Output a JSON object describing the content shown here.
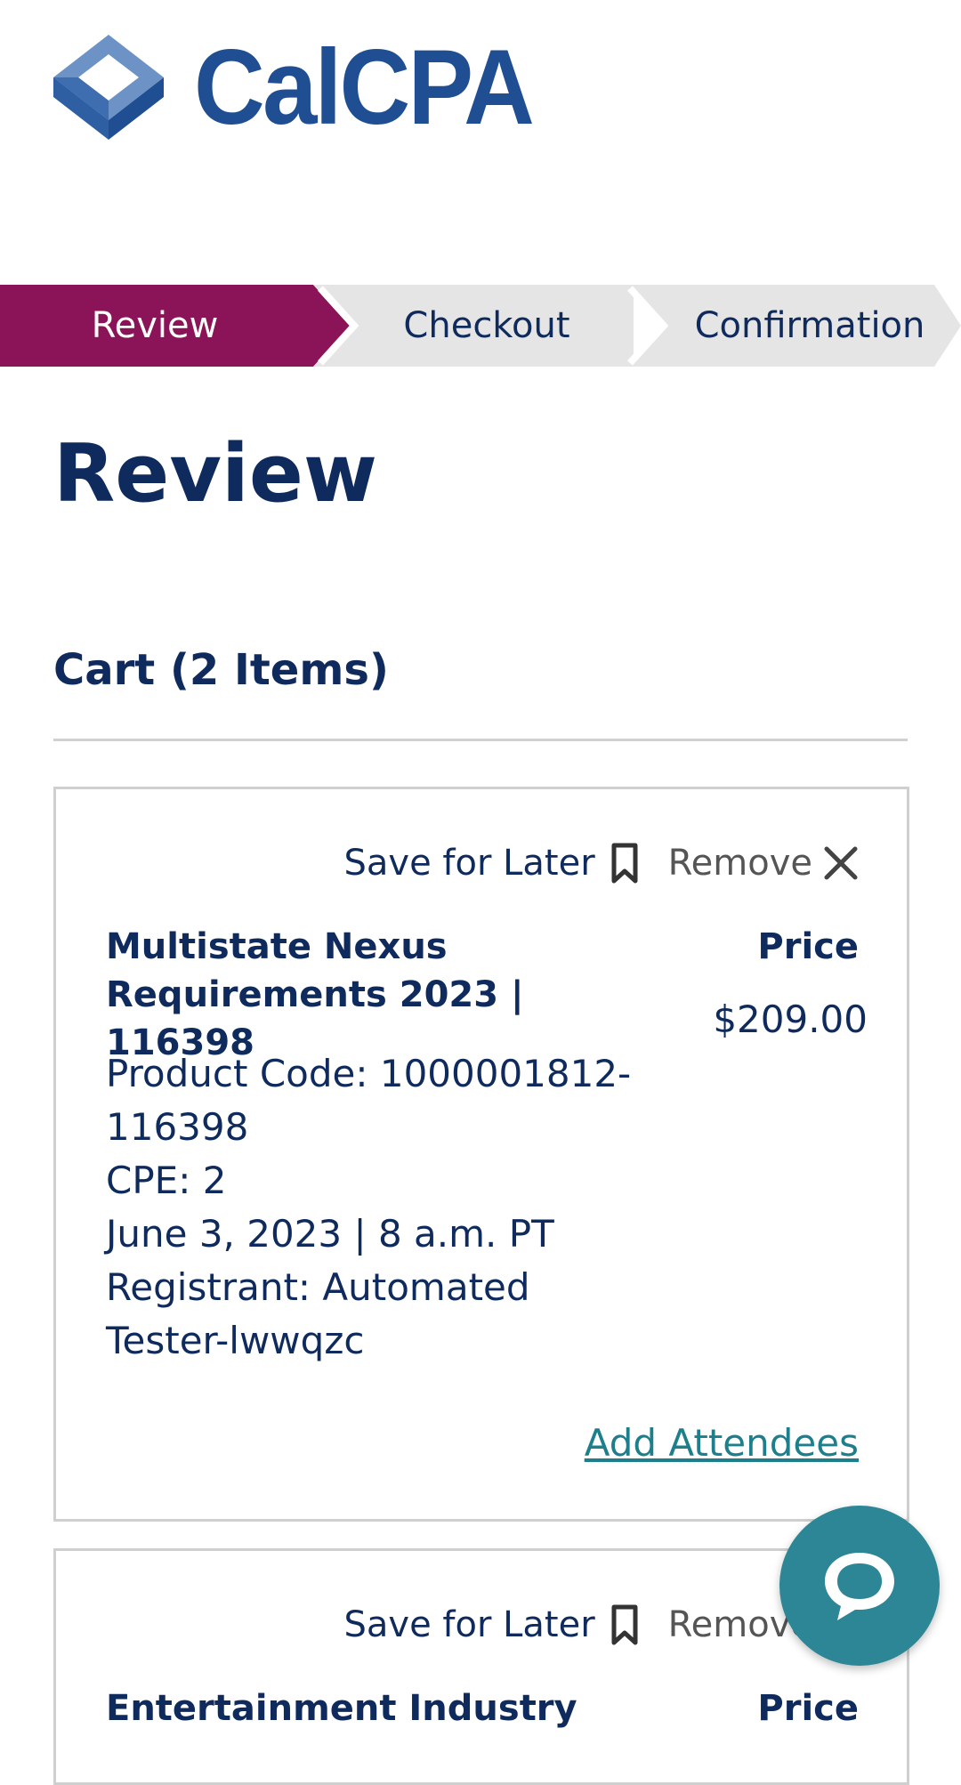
{
  "header": {
    "logo_text": "CalCPA"
  },
  "steps": [
    {
      "label": "Review",
      "active": true
    },
    {
      "label": "Checkout",
      "active": false
    },
    {
      "label": "Confirmation",
      "active": false
    }
  ],
  "page_title": "Review",
  "cart": {
    "title": "Cart (2 Items)",
    "items": [
      {
        "save_label": "Save for Later",
        "remove_label": "Remove",
        "name": "Multistate Nexus Requirements 2023 | 116398",
        "price_label": "Price",
        "price": "$209.00",
        "details": [
          "Product Code: 1000001812-116398",
          "CPE: 2",
          "June 3, 2023 | 8 a.m. PT",
          "Registrant: Automated Tester-lwwqzc"
        ],
        "add_attendees_label": "Add Attendees"
      },
      {
        "save_label": "Save for Later",
        "remove_label": "Remove",
        "name": "Entertainment Industry",
        "price_label": "Price"
      }
    ]
  },
  "colors": {
    "active_step": "#8a1457",
    "inactive_step": "#e5e5e5",
    "navy": "#0f2a5c",
    "link": "#1e7f8c",
    "chat": "#2c8696"
  },
  "icons": [
    "logo-cube-icon",
    "bookmark-icon",
    "close-icon",
    "chat-icon"
  ]
}
